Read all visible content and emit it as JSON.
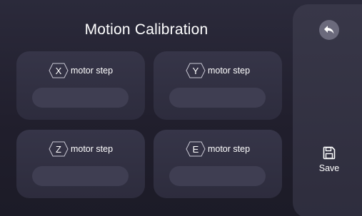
{
  "title": "Motion Calibration",
  "axes": [
    {
      "letter": "X",
      "label": "motor step",
      "value": ""
    },
    {
      "letter": "Y",
      "label": "motor step",
      "value": ""
    },
    {
      "letter": "Z",
      "label": "motor step",
      "value": ""
    },
    {
      "letter": "E",
      "label": "motor step",
      "value": ""
    }
  ],
  "sidebar": {
    "back_icon": "back-arrow-icon",
    "save_icon": "floppy-disk-icon",
    "save_label": "Save"
  },
  "colors": {
    "background": "#2b2a3b",
    "card": "#363548",
    "input": "#3f3e52",
    "back_button": "#6b6a7c",
    "text": "#ffffff"
  }
}
